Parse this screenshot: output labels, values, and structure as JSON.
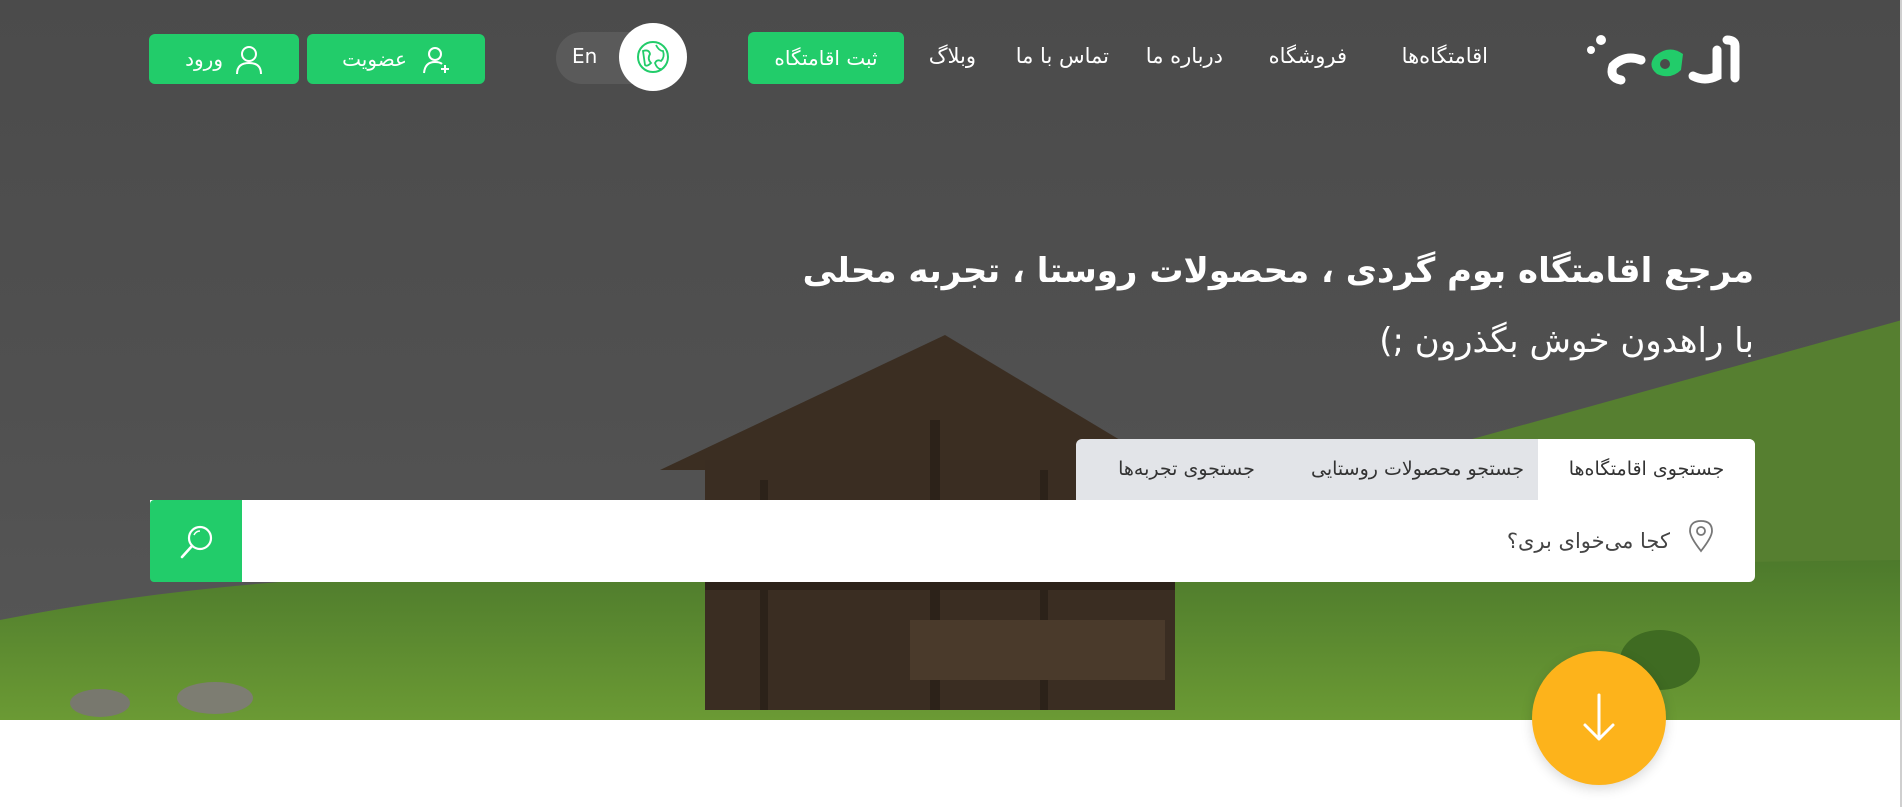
{
  "header": {
    "logo_text": "راهدون",
    "nav": {
      "stays": "اقامتگاه‌ها",
      "shop": "فروشگاه",
      "about": "درباره ما",
      "contact": "تماس با ما",
      "blog": "وبلاگ"
    },
    "register_stay_label": "ثبت اقامتگاه",
    "language_label": "En",
    "signup_label": "عضویت",
    "login_label": "ورود"
  },
  "hero": {
    "title": "مرجع اقامتگاه بوم گردی ، محصولات روستا ، تجربه محلی",
    "subtitle": "با راهدون خوش بگذرون ;)"
  },
  "search": {
    "tabs": [
      {
        "label": "جستجوی اقامتگاه‌ها",
        "active": true
      },
      {
        "label": "جستجو محصولات روستایی",
        "active": false
      },
      {
        "label": "جستجوی تجربه‌ها",
        "active": false
      }
    ],
    "placeholder": "کجا می‌خوای بری؟"
  },
  "colors": {
    "brand_green": "#22cc6a",
    "accent_yellow": "#fdb31b"
  },
  "icons": {
    "globe": "globe-icon",
    "user_plus": "user-plus-icon",
    "user": "user-icon",
    "search": "search-icon",
    "location": "location-pin-icon",
    "arrow_down": "arrow-down-icon"
  }
}
